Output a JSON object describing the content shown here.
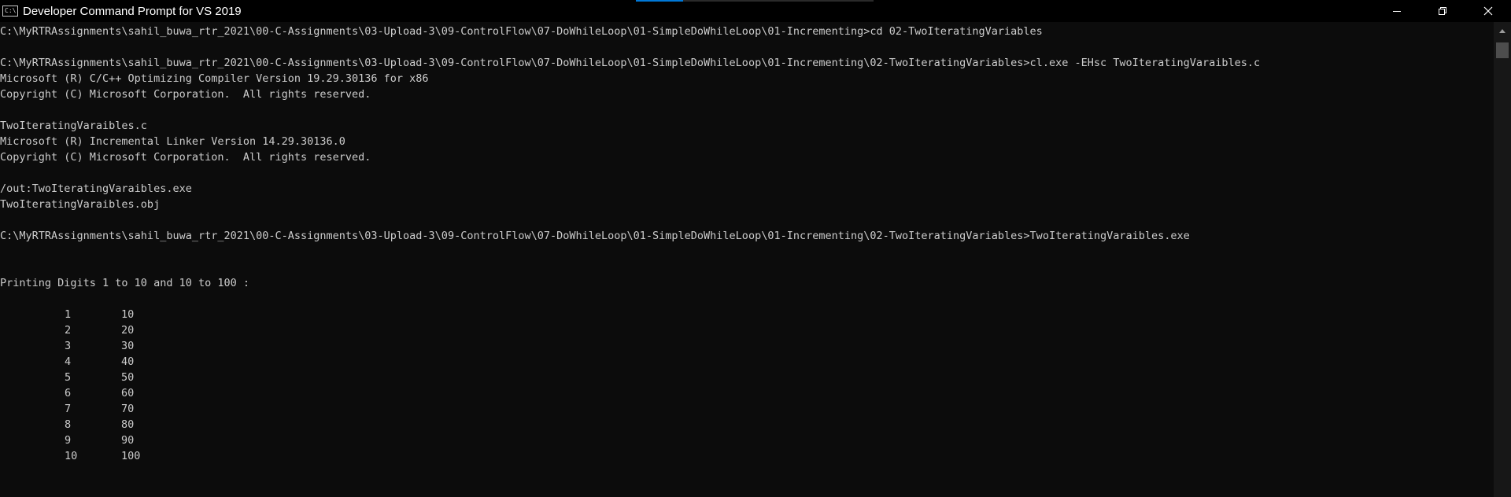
{
  "window": {
    "title": "Developer Command Prompt for VS 2019",
    "icon_glyph": "C:\\",
    "controls": {
      "minimize_icon": "minimize-icon",
      "maximize_icon": "restore-icon",
      "close_icon": "close-icon"
    }
  },
  "console": {
    "lines_top": [
      "C:\\MyRTRAssignments\\sahil_buwa_rtr_2021\\00-C-Assignments\\03-Upload-3\\09-ControlFlow\\07-DoWhileLoop\\01-SimpleDoWhileLoop\\01-Incrementing>cd 02-TwoIteratingVariables",
      "",
      "C:\\MyRTRAssignments\\sahil_buwa_rtr_2021\\00-C-Assignments\\03-Upload-3\\09-ControlFlow\\07-DoWhileLoop\\01-SimpleDoWhileLoop\\01-Incrementing\\02-TwoIteratingVariables>cl.exe -EHsc TwoIteratingVaraibles.c",
      "Microsoft (R) C/C++ Optimizing Compiler Version 19.29.30136 for x86",
      "Copyright (C) Microsoft Corporation.  All rights reserved.",
      "",
      "TwoIteratingVaraibles.c",
      "Microsoft (R) Incremental Linker Version 14.29.30136.0",
      "Copyright (C) Microsoft Corporation.  All rights reserved.",
      "",
      "/out:TwoIteratingVaraibles.exe",
      "TwoIteratingVaraibles.obj",
      "",
      "C:\\MyRTRAssignments\\sahil_buwa_rtr_2021\\00-C-Assignments\\03-Upload-3\\09-ControlFlow\\07-DoWhileLoop\\01-SimpleDoWhileLoop\\01-Incrementing\\02-TwoIteratingVariables>TwoIteratingVaraibles.exe",
      "",
      "",
      "Printing Digits 1 to 10 and 10 to 100 :",
      ""
    ],
    "table": [
      [
        "1",
        "10"
      ],
      [
        "2",
        "20"
      ],
      [
        "3",
        "30"
      ],
      [
        "4",
        "40"
      ],
      [
        "5",
        "50"
      ],
      [
        "6",
        "60"
      ],
      [
        "7",
        "70"
      ],
      [
        "8",
        "80"
      ],
      [
        "9",
        "90"
      ],
      [
        "10",
        "100"
      ]
    ]
  },
  "colors": {
    "background": "#0c0c0c",
    "text": "#cccccc",
    "titlebar": "#000000",
    "accent": "#0078d7"
  }
}
